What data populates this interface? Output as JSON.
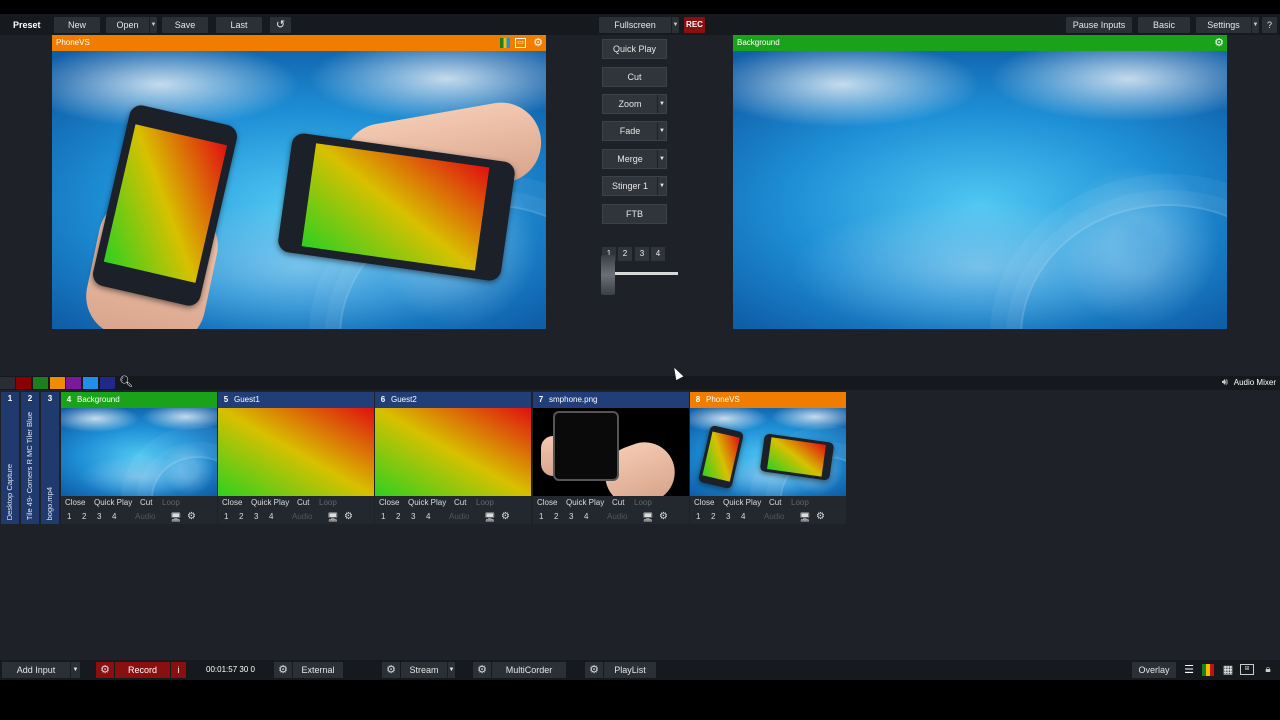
{
  "toolbar": {
    "preset": "Preset",
    "new": "New",
    "open": "Open",
    "save": "Save",
    "last": "Last",
    "fullscreen": "Fullscreen",
    "rec": "REC",
    "pause_inputs": "Pause Inputs",
    "basic": "Basic",
    "settings": "Settings",
    "help": "?"
  },
  "preview": {
    "title": "PhoneVS",
    "color": "#f07d00"
  },
  "output": {
    "title": "Background",
    "color": "#1aa31a"
  },
  "transitions": {
    "quick_play": "Quick Play",
    "cut": "Cut",
    "zoom": "Zoom",
    "fade": "Fade",
    "merge": "Merge",
    "stinger": "Stinger 1",
    "ftb": "FTB",
    "numbers": [
      "1",
      "2",
      "3",
      "4"
    ]
  },
  "colorbar": {
    "swatches": [
      "#2a2d33",
      "#8b0000",
      "#1e7d1e",
      "#f08c00",
      "#7a1a9a",
      "#1e90e8",
      "#22288a"
    ],
    "audio_mixer": "Audio Mixer"
  },
  "side_inputs": [
    {
      "num": "1",
      "label": "Desktop Capture"
    },
    {
      "num": "2",
      "label": "Tile 49- Corners R  MC Tiler Blue"
    },
    {
      "num": "3",
      "label": "bogo.mp4"
    }
  ],
  "inputs": [
    {
      "num": "4",
      "name": "Background",
      "head_color": "#1aa31a"
    },
    {
      "num": "5",
      "name": "Guest1",
      "head_color": "#223e78"
    },
    {
      "num": "6",
      "name": "Guest2",
      "head_color": "#223e78"
    },
    {
      "num": "7",
      "name": "smphone.png",
      "head_color": "#223e78"
    },
    {
      "num": "8",
      "name": "PhoneVS",
      "head_color": "#f07d00"
    }
  ],
  "tile_controls": {
    "close": "Close",
    "quick_play": "Quick Play",
    "cut": "Cut",
    "loop": "Loop",
    "n1": "1",
    "n2": "2",
    "n3": "3",
    "n4": "4",
    "audio": "Audio"
  },
  "bottom": {
    "add_input": "Add Input",
    "record": "Record",
    "info": "i",
    "timecode": "00:01:57 30 0",
    "external": "External",
    "stream": "Stream",
    "multicorder": "MultiCorder",
    "playlist": "PlayList",
    "overlay": "Overlay"
  }
}
